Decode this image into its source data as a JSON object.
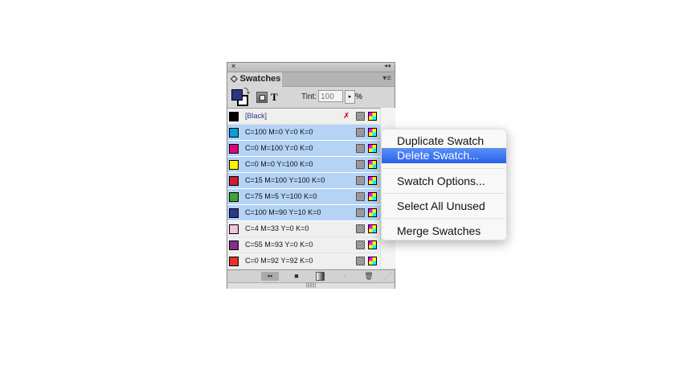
{
  "panel": {
    "close": "×",
    "collapse": "◂◂",
    "tab": "Swatches",
    "tab_icon": "◇",
    "menu_icon": "▾≡",
    "tint_label": "Tint:",
    "tint_value": "100",
    "tint_arrow": "▸",
    "percent": "%",
    "text_tool": "T"
  },
  "swatches": [
    {
      "name": "[Black]",
      "color": "#000000",
      "selected": false
    },
    {
      "name": "C=100 M=0 Y=0 K=0",
      "color": "#00a0e0",
      "selected": true
    },
    {
      "name": "C=0 M=100 Y=0 K=0",
      "color": "#e0007a",
      "selected": true
    },
    {
      "name": "C=0 M=0 Y=100 K=0",
      "color": "#fff200",
      "selected": true
    },
    {
      "name": "C=15 M=100 Y=100 K=0",
      "color": "#cf1f2e",
      "selected": true
    },
    {
      "name": "C=75 M=5 Y=100 K=0",
      "color": "#3fa535",
      "selected": true
    },
    {
      "name": "C=100 M=90 Y=10 K=0",
      "color": "#283a8c",
      "selected": true
    },
    {
      "name": "C=4 M=33 Y=0 K=0",
      "color": "#f2c4de",
      "selected": false
    },
    {
      "name": "C=55 M=93 Y=0 K=0",
      "color": "#8a2b8e",
      "selected": false
    },
    {
      "name": "C=0 M=92 Y=92 K=0",
      "color": "#e8302a",
      "selected": false
    }
  ],
  "menu": {
    "items": [
      "Duplicate Swatch",
      "Delete Swatch...",
      "Swatch Options...",
      "Select All Unused",
      "Merge Swatches"
    ]
  }
}
